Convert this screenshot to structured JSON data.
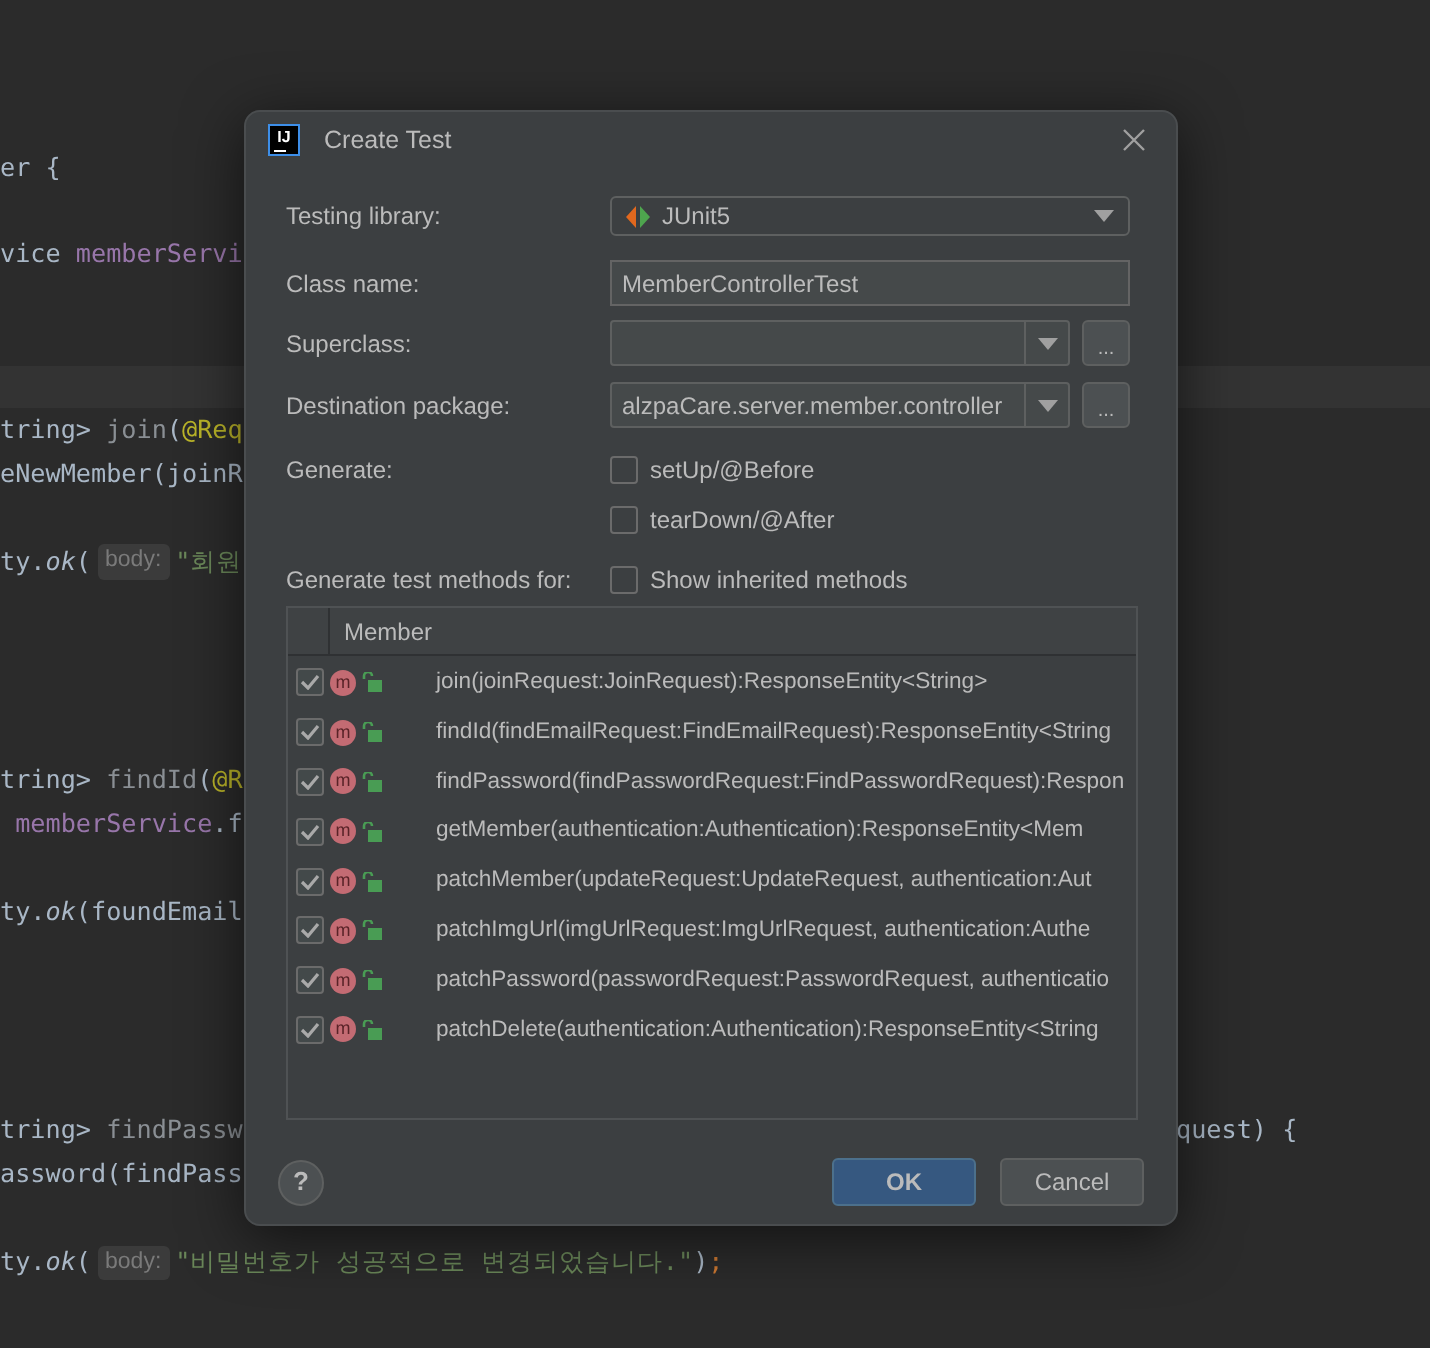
{
  "editor": {
    "current_line_highlight": true,
    "lines": [
      {
        "segments": [
          {
            "text": "er {",
            "kind": "plain"
          }
        ]
      },
      {
        "segments": [
          {
            "text": "vice ",
            "kind": "plain"
          },
          {
            "text": "memberServi",
            "kind": "field"
          }
        ]
      },
      {
        "segments": [
          {
            "text": "tring> ",
            "kind": "plain"
          },
          {
            "text": "join",
            "kind": "unused"
          },
          {
            "text": "(",
            "kind": "plain"
          },
          {
            "text": "@Req",
            "kind": "annotation"
          }
        ]
      },
      {
        "segments": [
          {
            "text": "eNewMember(joinR",
            "kind": "plain"
          }
        ]
      },
      {
        "segments": [
          {
            "text": "ty.",
            "kind": "plain"
          },
          {
            "text": "ok",
            "kind": "italic"
          },
          {
            "text": "(",
            "kind": "plain"
          },
          {
            "text": "body:",
            "kind": "hint"
          },
          {
            "text": "\"회원",
            "kind": "string"
          }
        ]
      },
      {
        "segments": [
          {
            "text": "tring> ",
            "kind": "plain"
          },
          {
            "text": "findId",
            "kind": "unused"
          },
          {
            "text": "(",
            "kind": "plain"
          },
          {
            "text": "@R",
            "kind": "annotation"
          }
        ]
      },
      {
        "segments": [
          {
            "text": " memberService",
            "kind": "field"
          },
          {
            "text": ".f",
            "kind": "plain"
          }
        ]
      },
      {
        "segments": [
          {
            "text": "ty.",
            "kind": "plain"
          },
          {
            "text": "ok",
            "kind": "italic"
          },
          {
            "text": "(foundEmail",
            "kind": "plain"
          }
        ]
      },
      {
        "segments": [
          {
            "text": "tring> ",
            "kind": "plain"
          },
          {
            "text": "findPassw",
            "kind": "unused"
          }
        ],
        "tail": [
          {
            "text": "quest) {",
            "kind": "plain"
          }
        ]
      },
      {
        "segments": [
          {
            "text": "assword(findPass",
            "kind": "plain"
          }
        ]
      },
      {
        "segments": [
          {
            "text": "ty.",
            "kind": "plain"
          },
          {
            "text": "ok",
            "kind": "italic"
          },
          {
            "text": "(",
            "kind": "plain"
          },
          {
            "text": "body:",
            "kind": "hint"
          },
          {
            "text": "\"비밀번호가 성공적으로 변경되었습니다.\"",
            "kind": "string"
          },
          {
            "text": ")",
            "kind": "plain"
          },
          {
            "text": ";",
            "kind": "keyword"
          }
        ]
      }
    ]
  },
  "dialog": {
    "logo": "IJ",
    "title": "Create Test",
    "fields": [
      {
        "kind": "combo",
        "label": "Testing library:",
        "value": "JUnit5"
      },
      {
        "kind": "text",
        "label": "Class name:",
        "value": "MemberControllerTest"
      },
      {
        "kind": "combo_browse",
        "label": "Superclass:",
        "button": "..."
      },
      {
        "kind": "combo_browse",
        "label": "Destination package:",
        "value": "alzpaCare.server.member.controller",
        "button": "..."
      }
    ],
    "generate": {
      "label": "Generate:",
      "options": [
        {
          "label": "setUp/@Before",
          "checked": false
        },
        {
          "label": "tearDown/@After",
          "checked": false
        }
      ]
    },
    "methods_for": {
      "label": "Generate test methods for:",
      "option": {
        "label": "Show inherited methods",
        "checked": false
      }
    },
    "table": {
      "columns": [
        "Member"
      ],
      "rows": [
        {
          "checked": true,
          "badge": "m",
          "text": "join(joinRequest:JoinRequest):ResponseEntity<String>"
        },
        {
          "checked": true,
          "badge": "m",
          "text": "findId(findEmailRequest:FindEmailRequest):ResponseEntity<String"
        },
        {
          "checked": true,
          "badge": "m",
          "text": "findPassword(findPasswordRequest:FindPasswordRequest):Respon"
        },
        {
          "checked": true,
          "badge": "m",
          "text": "getMember(authentication:Authentication):ResponseEntity<Mem"
        },
        {
          "checked": true,
          "badge": "m",
          "text": "patchMember(updateRequest:UpdateRequest, authentication:Aut"
        },
        {
          "checked": true,
          "badge": "m",
          "text": "patchImgUrl(imgUrlRequest:ImgUrlRequest, authentication:Authe"
        },
        {
          "checked": true,
          "badge": "m",
          "text": "patchPassword(passwordRequest:PasswordRequest, authenticatio"
        },
        {
          "checked": true,
          "badge": "m",
          "text": "patchDelete(authentication:Authentication):ResponseEntity<String"
        }
      ]
    },
    "help": "?",
    "buttons": [
      {
        "label": "OK",
        "default": true
      },
      {
        "label": "Cancel",
        "default": false
      }
    ]
  }
}
